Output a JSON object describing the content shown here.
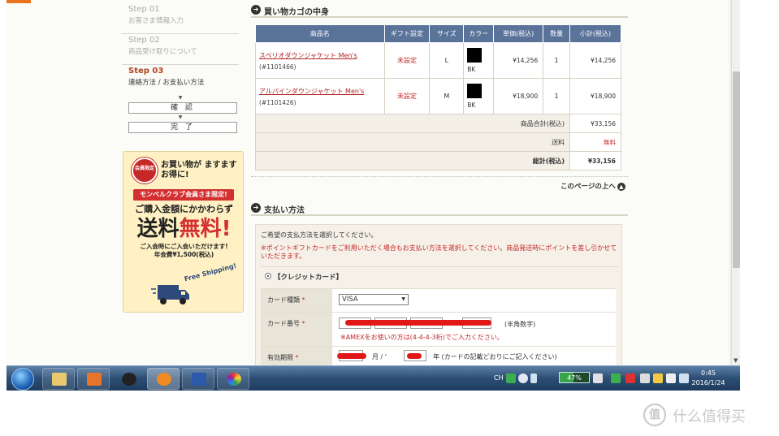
{
  "sidebar": {
    "steps": [
      {
        "num": "Step 01",
        "label": "お客さま情報入力"
      },
      {
        "num": "Step 02",
        "label": "商品受け取りについて"
      },
      {
        "num": "Step 03",
        "label": "連絡方法 / お支払い方法"
      }
    ],
    "confirm_label": "確 認",
    "complete_label": "完 了",
    "arrow": "▼"
  },
  "promo": {
    "badge": "会員限定",
    "headline": "お買い物が ますますお得に!",
    "member_bar": "モンベルクラブ会員さま限定!",
    "line2": "ご購入金額にかかわらず",
    "big_black": "送料",
    "big_red": "無料!",
    "small1": "ご入会時にご入会いただけます!",
    "small2": "年会費¥1,500(税込)",
    "free": "Free Shipping!"
  },
  "cart": {
    "section_title": "買い物カゴの中身",
    "headers": [
      "商品名",
      "ギフト設定",
      "サイズ",
      "カラー",
      "単価(税込)",
      "数量",
      "小計(税込)"
    ],
    "items": [
      {
        "name": "スペリオダウンジャケット Men's",
        "code": "(#1101466)",
        "gift": "未設定",
        "size": "L",
        "color": "BK",
        "color_hex": "#000000",
        "price": "¥14,256",
        "qty": "1",
        "subtotal": "¥14,256"
      },
      {
        "name": "アルパインダウンジャケット Men's",
        "code": "(#1101426)",
        "gift": "未設定",
        "size": "M",
        "color": "BK",
        "color_hex": "#000000",
        "price": "¥18,900",
        "qty": "1",
        "subtotal": "¥18,900"
      }
    ],
    "goods_total_label": "商品合計(税込)",
    "goods_total": "¥33,156",
    "shipping_label": "送料",
    "shipping": "無料",
    "grand_total_label": "総計(税込)",
    "grand_total": "¥33,156",
    "page_top": "このページの上へ"
  },
  "payment": {
    "section_title": "支払い方法",
    "instruction": "ご希望の支払方法を選択してください。",
    "notice": "※ポイントギフトカードをご利用いただく場合もお支払い方法を選択してください。商品発送時にポイントを差し引かせていただきます。",
    "method_label": "【クレジットカード】",
    "card_type_label": "カード種類",
    "card_type_value": "VISA",
    "card_number_label": "カード番号",
    "card_number_hint": "(半角数字)",
    "amex_note": "※AMEXをお使いの方は(4-4-4-3桁)でご入力ください。",
    "expiry_label": "有効期限",
    "month_label": "月 / '",
    "year_label": "年 (カードの記載どおりにご記入ください)",
    "required_mark": "*"
  },
  "taskbar": {
    "lang": "CH",
    "battery": "47%",
    "battery_fraction": 0.47,
    "time": "0:45",
    "date": "2016/1/24"
  },
  "watermark": {
    "symbol": "值",
    "text": "什么值得买"
  }
}
